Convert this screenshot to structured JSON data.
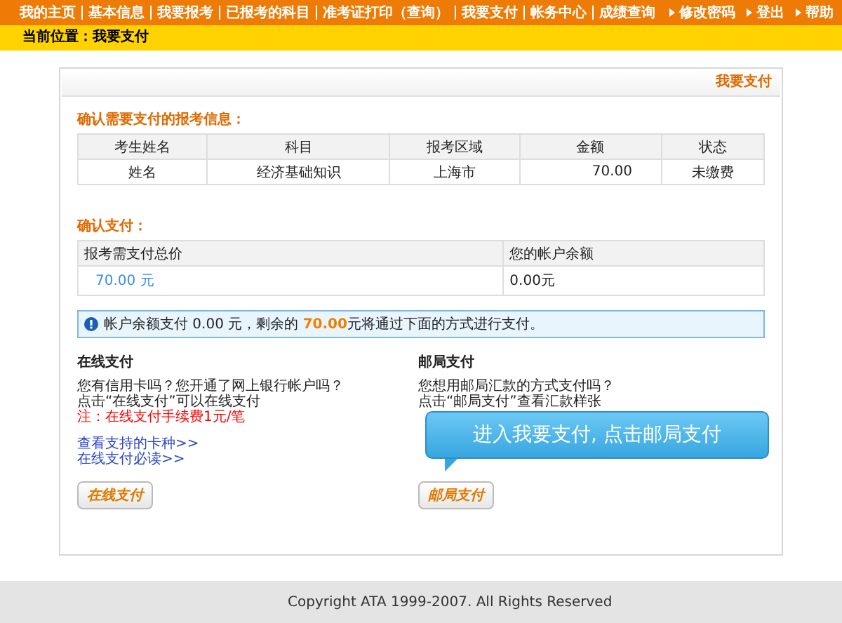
{
  "nav": {
    "items": [
      "我的主页",
      "基本信息",
      "我要报考",
      "已报考的科目",
      "准考证打印（查询）",
      "我要支付",
      "帐务中心",
      "成绩查询"
    ],
    "right_links": [
      "修改密码",
      "登出",
      "帮助"
    ]
  },
  "breadcrumb": "当前位置：我要支付",
  "panel": {
    "title": "我要支付",
    "exam_section": {
      "heading": "确认需要支付的报考信息：",
      "columns": [
        "考生姓名",
        "科目",
        "报考区域",
        "金额",
        "状态"
      ],
      "rows": [
        [
          "姓名",
          "经济基础知识",
          "上海市",
          "70.00",
          "未缴费"
        ]
      ]
    },
    "confirm_section": {
      "heading": "确认支付：",
      "columns": [
        "报考需支付总价",
        "您的帐户余额"
      ],
      "total": "70.00 元",
      "balance": "0.00元"
    },
    "notice": "帐户余额支付 0.00 元，剩余的 **70.00**元将通过下面的方式进行支付。",
    "methods": [
      {
        "kind": "online",
        "title": "在线支付",
        "lines": [
          "您有信用卡吗？您开通了网上银行帐户吗？",
          "点击“在线支付”可以在线支付"
        ],
        "note": "注：在线支付手续费1元/笔",
        "links": [
          "查看支持的卡种>>",
          "在线支付必读>>"
        ],
        "button": "在线支付"
      },
      {
        "kind": "post",
        "title": "邮局支付",
        "lines": [
          "您想用邮局汇款的方式支付吗？",
          "点击“邮局支付”查看汇款样张"
        ],
        "button": "邮局支付"
      }
    ]
  },
  "callout": "进入我要支付, 点击邮局支付",
  "footer": "Copyright ATA 1999-2007. All Rights Reserved"
}
